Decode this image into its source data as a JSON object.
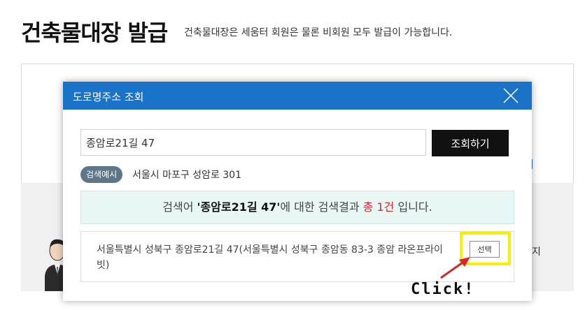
{
  "page": {
    "title": "건축물대장 발급",
    "subtitle": "건축물대장은 세움터 회원은 물론 비회원 모두 발급이 가능합니다."
  },
  "background": {
    "side_text": "지"
  },
  "modal": {
    "title": "도로명주소 조회",
    "search_value": "종암로21길 47",
    "search_button_label": "조회하기",
    "example_badge": "검색예시",
    "example_text": "서울시 마포구 성암로 301",
    "summary": {
      "prefix": "검색어 ",
      "keyword": "'종암로21길 47'",
      "middle": "에 대한 검색결과 ",
      "count": "총 1건",
      "suffix": " 입니다."
    },
    "results": [
      {
        "address": "서울특별시 성북구 종암로21길 47(서울특별시 성북구 종암동 83-3 종암 라온프라이빗)",
        "select_label": "선택"
      }
    ]
  },
  "annotation": {
    "label": "Click!",
    "highlight_color": "#f7f000",
    "arrow_color": "#d7262d"
  },
  "colors": {
    "header_blue": "#1a73c9",
    "summary_bg": "#e8f6f6",
    "badge_bg": "#5e7689",
    "count_red": "#d7262d"
  },
  "icons": {
    "close": "close-icon",
    "avatar": "user-avatar-icon"
  }
}
